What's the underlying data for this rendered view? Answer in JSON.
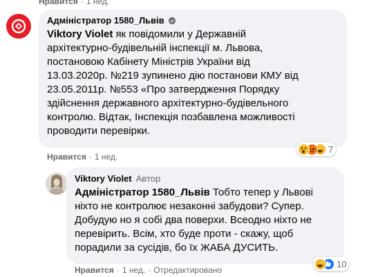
{
  "top_meta": {
    "like": "Нравится",
    "time": "1 нед."
  },
  "comment1": {
    "author": "Адміністратор 1580_Львів",
    "verified_icon": "verified-badge-icon",
    "mention": "Viktory Violet",
    "lines": [
      " як повідомили у Державній",
      "архітектурно-будівельній інспекції м. Львова,",
      "постановою Кабінету Міністрів України від",
      "13.03.2020р. №219 зупинено дію постанови КМУ від",
      "23.05.2011р. №553 «Про затвердження Порядку",
      "здійснення державного архітектурно-будівельного",
      "контролю. Відтак, Інспекція позбавлена можливості",
      "проводити перевірки."
    ],
    "meta": {
      "like": "Нравится",
      "reply": "Ответить",
      "time": "1 нед."
    },
    "reactions": {
      "icons": [
        "wow-reaction-icon",
        "angry-reaction-icon",
        "haha-reaction-icon"
      ],
      "count": "7"
    }
  },
  "comment2": {
    "author": "Viktory Violet",
    "author_badge": "Автор",
    "mention": "Адміністратор 1580_Львів",
    "lines": [
      " Тобто тепер у Львові",
      "ніхто не контролює незаконні забудови? Супер.",
      "Добудую но я собі два поверхи. Всеодно ніхто не",
      "перевірить. Всім, хто буде проти - скажу, щоб",
      "порадили за сусідів, бо їх ЖАБА ДУСИТЬ."
    ],
    "meta": {
      "like": "Нравится",
      "reply": "Ответить",
      "time": "1 нед.",
      "edited": "Отредактировано"
    },
    "reactions": {
      "icons": [
        "haha-reaction-icon",
        "like-reaction-icon"
      ],
      "count": "10"
    }
  },
  "colors": {
    "bubble": "#f0f2f5",
    "meta_text": "#65676b",
    "admin_avatar": "#e41e26",
    "like_blue": "#1877f2",
    "haha_yellow": "#f7b928",
    "angry_red": "#e9710f"
  }
}
